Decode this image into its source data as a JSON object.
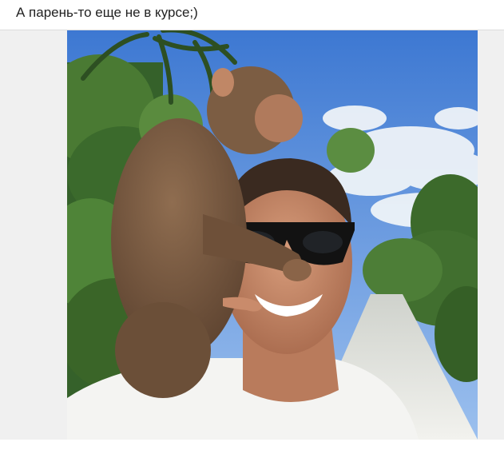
{
  "post": {
    "caption": "А парень-то еще не в курсе;)"
  },
  "photo": {
    "subject_icon": "photo-image",
    "colors": {
      "sky": "#4f86d8",
      "cloud": "#eef3f8",
      "foliage": "#3e6b2c",
      "path": "#d9d9d6",
      "shirt": "#f4f4f2",
      "skin": "#c78a6a",
      "monkey_fur": "#7a5c43",
      "sunglasses": "#121212"
    }
  }
}
